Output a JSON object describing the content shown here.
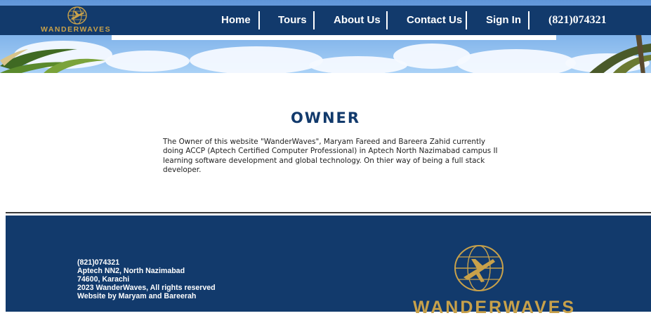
{
  "header": {
    "brand_name": "WANDERWAVES",
    "nav": [
      {
        "label": "Home"
      },
      {
        "label": "Tours"
      },
      {
        "label": "About Us"
      },
      {
        "label": "Contact Us"
      },
      {
        "label": "Sign In"
      }
    ],
    "phone": "(821)074321"
  },
  "main": {
    "title": "OWNER",
    "body": "The Owner of this website \"WanderWaves\", Maryam Fareed and Bareera Zahid currently doing ACCP (Aptech Certified Computer Professional) in Aptech North Nazimabad campus II learning software development and global technology. On thier way of being a full stack developer."
  },
  "footer": {
    "lines": [
      "(821)074321",
      "Aptech NN2, North Nazimabad",
      "74600, Karachi",
      "2023 WanderWaves, All rights reserved",
      "Website by Maryam and Bareerah"
    ],
    "brand_name": "WANDERWAVES"
  },
  "colors": {
    "navy": "#123a6c",
    "gold": "#c8a14a",
    "white": "#ffffff"
  },
  "icons": {
    "brand_logo": "globe-airplane-icon",
    "footer_logo": "globe-airplane-icon"
  }
}
